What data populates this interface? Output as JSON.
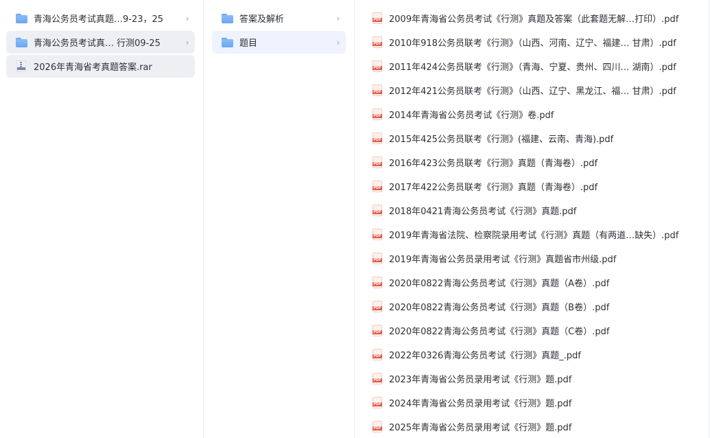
{
  "column1": {
    "items": [
      {
        "label": "青海公务员考试真题…9-23，25",
        "type": "folder",
        "state": "normal",
        "chevron": "›"
      },
      {
        "label": "青海公务员考试真…  行测09-25",
        "type": "folder",
        "state": "selected",
        "chevron": "›"
      },
      {
        "label": "2026年青海省考真题答案.rar",
        "type": "rar",
        "state": "highlight",
        "chevron": ""
      }
    ]
  },
  "column2": {
    "items": [
      {
        "label": "答案及解析",
        "type": "folder",
        "state": "normal",
        "chevron": "›"
      },
      {
        "label": "题目",
        "type": "folder",
        "state": "selected",
        "chevron": "›"
      }
    ]
  },
  "column3": {
    "pdf_badge": "PDF",
    "files": [
      "2009年青海省公务员考试《行测》真题及答案（此套题无解…打印）.pdf",
      "2010年918公务员联考《行测》（山西、河南、辽宁、福建… 甘肃）.pdf",
      "2011年424公务员联考《行测》（青海、宁夏、贵州、四川… 湖南）.pdf",
      "2012年421公务员联考《行测》（山西、辽宁、黑龙江、福… 甘肃）.pdf",
      "2014年青海省公务员考试《行测》卷.pdf",
      "2015年425公务员联考《行测》(福建、云南、青海).pdf",
      "2016年423公务员联考《行测》真题（青海卷）.pdf",
      "2017年422公务员联考《行测》真题（青海卷）.pdf",
      "2018年0421青海公务员考试《行测》真题.pdf",
      "2019年青海省法院、检察院录用考试《行测》真题（有两道…缺失）.pdf",
      "2019年青海省公务员录用考试《行测》真题省市州级.pdf",
      "2020年0822青海公务员考试《行测》真题（A卷）.pdf",
      "2020年0822青海公务员考试《行测》真题（B卷）.pdf",
      "2020年0822青海公务员考试《行测》真题（C卷）.pdf",
      "2022年0326青海公务员考试《行测》真题_.pdf",
      "2023年青海省公务员录用考试《行测》题.pdf",
      "2024年青海省公务员录用考试《行测》题.pdf",
      "2025年青海省公务员录用考试《行测》题.pdf"
    ]
  },
  "colors": {
    "selected_gray": "#eeeff2",
    "selected_blue": "#eef3fe",
    "folder": "#6aa6f4",
    "pdf_red": "#e25b45"
  }
}
